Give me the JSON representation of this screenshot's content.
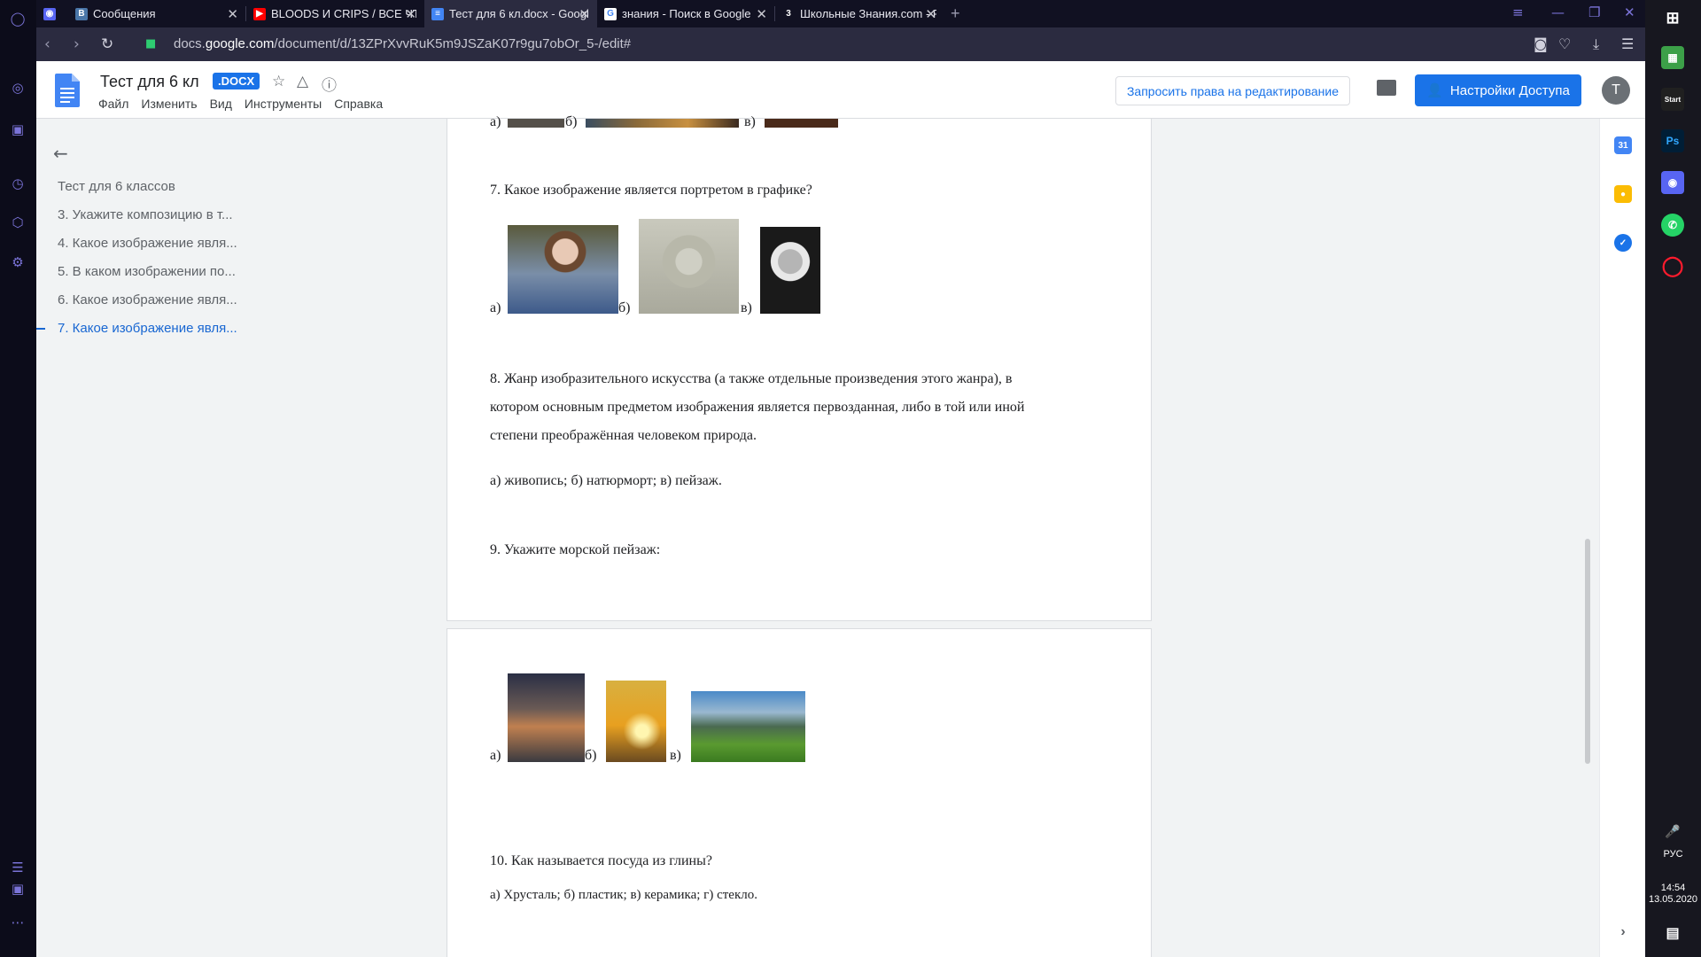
{
  "browser": {
    "tabs": [
      {
        "title": "Сообщения",
        "favicon": "vk-icon"
      },
      {
        "title": "BLOODS И CRIPS / ВСЕ ЧТ",
        "favicon": "youtube-icon"
      },
      {
        "title": "Тест для 6 кл.docx - Googl",
        "favicon": "docs-icon"
      },
      {
        "title": "знания - Поиск в Google",
        "favicon": "google-icon"
      },
      {
        "title": "Школьные Знания.com - F",
        "favicon": "znanija-icon"
      }
    ],
    "url_prefix": "docs.",
    "url_domain": "google.com",
    "url_path": "/document/d/13ZPrXvvRuK5m9JSZaK07r9gu7obOr_5-/edit#"
  },
  "docs": {
    "title": "Тест для 6 кл",
    "badge": ".DOCX",
    "menu": [
      "Файл",
      "Изменить",
      "Вид",
      "Инструменты",
      "Справка"
    ],
    "request_edit": "Запросить права на редактирование",
    "share": "Настройки Доступа",
    "avatar_letter": "T"
  },
  "outline": {
    "items": [
      "Тест для 6 классов",
      "3. Укажите композицию в т...",
      "4. Какое изображение явля...",
      "5. В каком изображении по...",
      "6. Какое изображение явля...",
      "7. Какое изображение явля..."
    ],
    "active_index": 5
  },
  "document": {
    "prev_options": [
      "а)",
      "б)",
      "в)"
    ],
    "q7": "7. Какое изображение является портретом в графике?",
    "q7_options": [
      "а)",
      "б)",
      "в)"
    ],
    "q8_lines": [
      "8. Жанр изобразительного искусства (а также отдельные произведения этого жанра), в",
      "котором основным предметом изображения является первозданная, либо в той или иной",
      "степени преображённая человеком природа."
    ],
    "q8_answers": "а) живопись; б) натюрморт;  в) пейзаж.",
    "q9": "9. Укажите морской пейзаж:",
    "q9_options": [
      "а)",
      "б)",
      "в)"
    ],
    "q10": "10. Как называется посуда из глины?",
    "q10_answers": "а) Хрусталь;    б) пластик;       в) керамика;      г) стекло."
  },
  "taskbar": {
    "language": "РУС",
    "time": "14:54",
    "date": "13.05.2020"
  }
}
